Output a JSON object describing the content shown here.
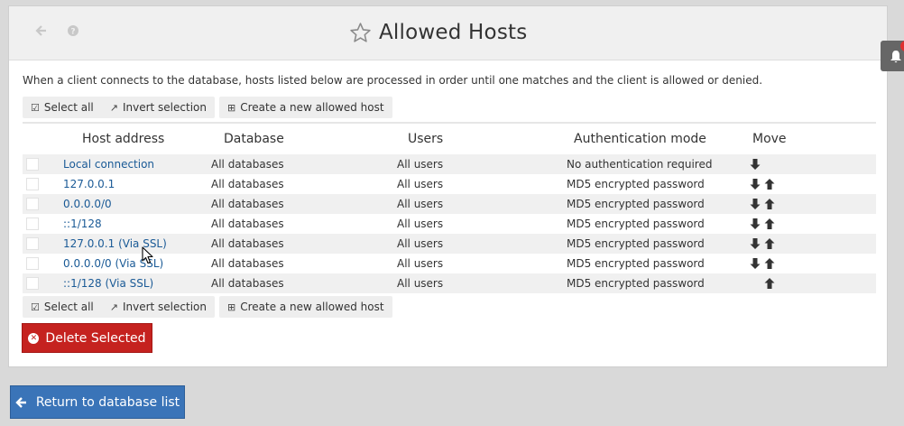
{
  "header": {
    "title": "Allowed Hosts",
    "back_icon": "arrow-left-icon",
    "help_icon": "question-circle-icon",
    "star_icon": "star-outline-icon"
  },
  "description": "When a client connects to the database, hosts listed below are processed in order until one matches and the client is allowed or denied.",
  "toolbar": {
    "select_all": "Select all",
    "invert_selection": "Invert selection",
    "create_host": "Create a new allowed host"
  },
  "table": {
    "columns": [
      "Host address",
      "Database",
      "Users",
      "Authentication mode",
      "Move"
    ],
    "rows": [
      {
        "host": "Local connection",
        "database": "All databases",
        "users": "All users",
        "auth": "No authentication required",
        "move_down": true,
        "move_up": false
      },
      {
        "host": "127.0.0.1",
        "database": "All databases",
        "users": "All users",
        "auth": "MD5 encrypted password",
        "move_down": true,
        "move_up": true
      },
      {
        "host": "0.0.0.0/0",
        "database": "All databases",
        "users": "All users",
        "auth": "MD5 encrypted password",
        "move_down": true,
        "move_up": true
      },
      {
        "host": "::1/128",
        "database": "All databases",
        "users": "All users",
        "auth": "MD5 encrypted password",
        "move_down": true,
        "move_up": true
      },
      {
        "host": "127.0.0.1 (Via SSL)",
        "database": "All databases",
        "users": "All users",
        "auth": "MD5 encrypted password",
        "move_down": true,
        "move_up": true
      },
      {
        "host": "0.0.0.0/0 (Via SSL)",
        "database": "All databases",
        "users": "All users",
        "auth": "MD5 encrypted password",
        "move_down": true,
        "move_up": true
      },
      {
        "host": "::1/128 (Via SSL)",
        "database": "All databases",
        "users": "All users",
        "auth": "MD5 encrypted password",
        "move_down": false,
        "move_up": true
      }
    ]
  },
  "actions": {
    "delete_selected": "Delete Selected",
    "return": "Return to database list"
  },
  "colors": {
    "link": "#1a5a96",
    "danger": "#c5221f",
    "primary": "#3a74b8"
  }
}
